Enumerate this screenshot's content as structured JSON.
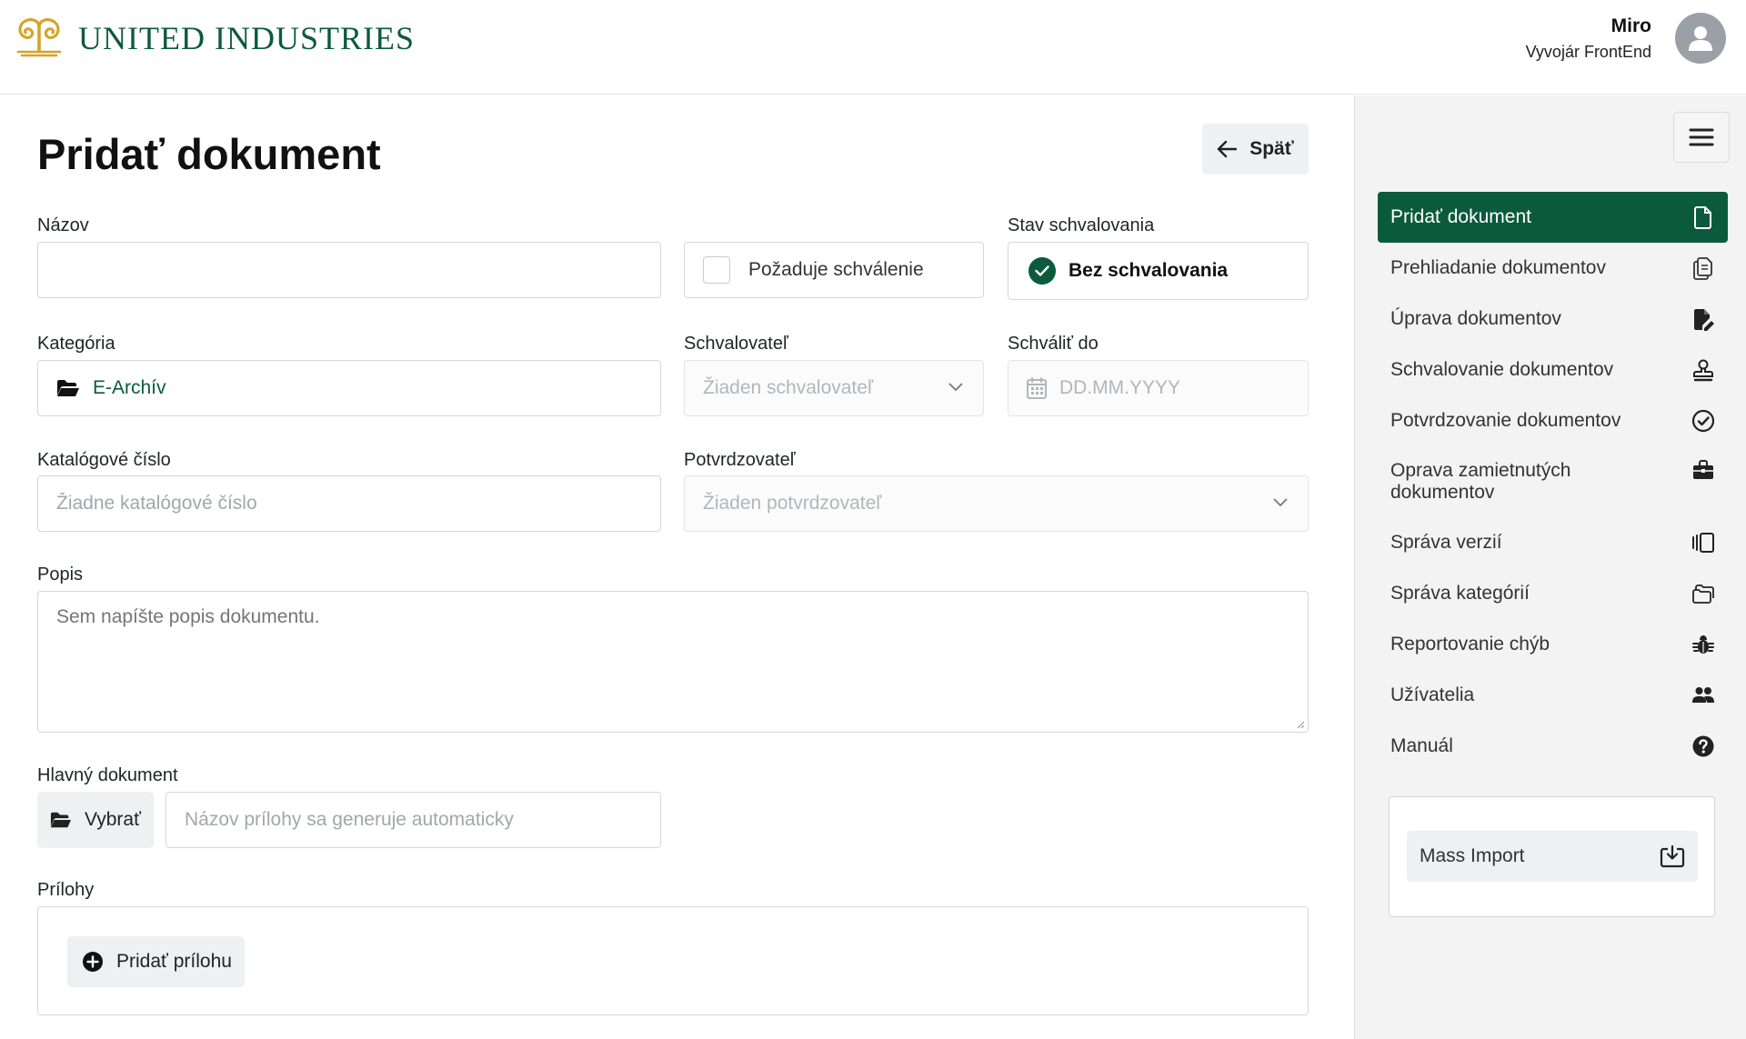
{
  "header": {
    "logo_text": "UNITED INDUSTRIES",
    "user_name": "Miro",
    "user_role": "Vyvojár FrontEnd"
  },
  "page": {
    "title": "Pridať dokument",
    "back_label": "Späť"
  },
  "form": {
    "name_label": "Názov",
    "name_value": "",
    "requires_approval_label": "Požaduje schválenie",
    "requires_approval_checked": false,
    "approval_status_label": "Stav schvalovania",
    "approval_status_value": "Bez schvalovania",
    "category_label": "Kategória",
    "category_value": "E-Archív",
    "approver_label": "Schvalovateľ",
    "approver_placeholder": "Žiaden schvalovateľ",
    "approve_by_label": "Schváliť do",
    "approve_by_placeholder": "DD.MM.YYYY",
    "catalog_label": "Katalógové číslo",
    "catalog_placeholder": "Žiadne katalógové číslo",
    "confirmer_label": "Potvrdzovateľ",
    "confirmer_placeholder": "Žiaden potvrdzovateľ",
    "description_label": "Popis",
    "description_placeholder": "Sem napíšte popis dokumentu.",
    "main_doc_label": "Hlavný dokument",
    "choose_label": "Vybrať",
    "attachment_name_placeholder": "Názov prílohy sa generuje automaticky",
    "attachments_label": "Prílohy",
    "add_attachment_label": "Pridať prílohu"
  },
  "sidebar": {
    "items": [
      {
        "label": "Pridať dokument",
        "icon": "file-icon",
        "active": true
      },
      {
        "label": "Prehliadanie dokumentov",
        "icon": "files-icon"
      },
      {
        "label": "Úprava dokumentov",
        "icon": "file-edit-icon"
      },
      {
        "label": "Schvalovanie dokumentov",
        "icon": "stamp-icon"
      },
      {
        "label": "Potvrdzovanie dokumentov",
        "icon": "check-circle-icon"
      },
      {
        "label": "Oprava zamietnutých dokumentov",
        "icon": "toolbox-icon"
      },
      {
        "label": "Správa verzií",
        "icon": "versions-icon"
      },
      {
        "label": "Správa kategórií",
        "icon": "folders-icon"
      },
      {
        "label": "Reportovanie chýb",
        "icon": "bug-icon"
      },
      {
        "label": "Užívatelia",
        "icon": "users-icon"
      },
      {
        "label": "Manuál",
        "icon": "question-circle-icon"
      }
    ],
    "mass_import_label": "Mass Import"
  },
  "colors": {
    "brand_green": "#0b5a3c",
    "logo_gold": "#d4a52a"
  }
}
